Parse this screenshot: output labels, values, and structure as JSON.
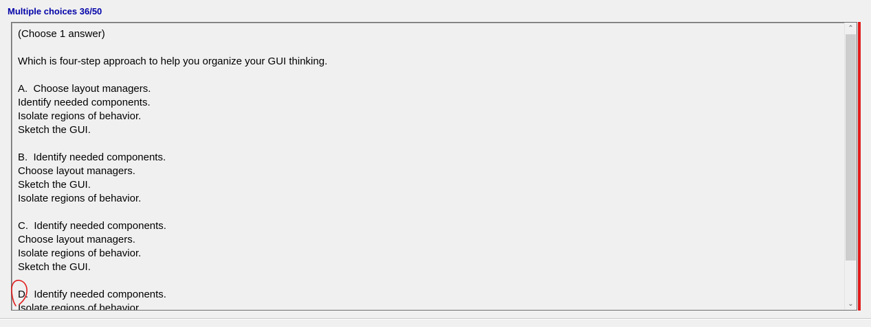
{
  "header": {
    "title": "Multiple choices 36/50",
    "color": "#0000a8"
  },
  "question": {
    "lines": [
      "(Choose 1 answer)",
      "",
      "Which is four-step approach to help you organize your GUI thinking.",
      "",
      "A.  Choose layout managers.",
      "Identify needed components.",
      "Isolate regions of behavior.",
      "Sketch the GUI.",
      "",
      "B.  Identify needed components.",
      "Choose layout managers.",
      "Sketch the GUI.",
      "Isolate regions of behavior.",
      "",
      "C.  Identify needed components.",
      "Choose layout managers.",
      "Isolate regions of behavior.",
      "Sketch the GUI.",
      "",
      "D.  Identify needed components.",
      "Isolate regions of behavior."
    ]
  },
  "scrollbar": {
    "up_icon": "chevron-up-icon",
    "down_icon": "chevron-down-icon"
  },
  "colors": {
    "accent_bar": "#e01a1a",
    "annotation": "#e01a1a"
  }
}
